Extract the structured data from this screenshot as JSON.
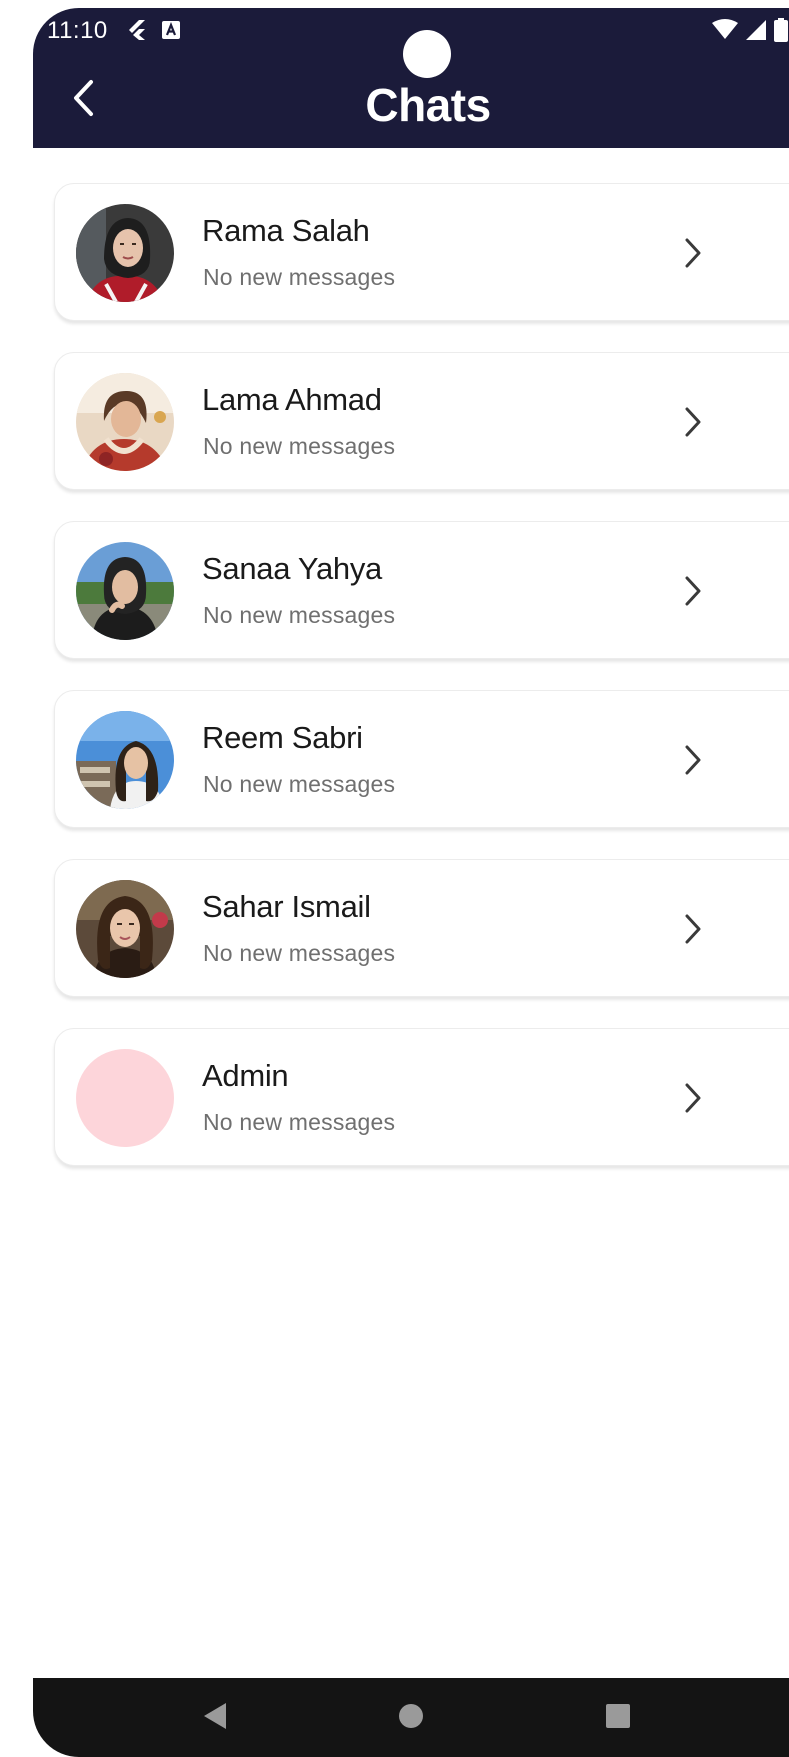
{
  "status_bar": {
    "time": "11:10",
    "left_icons": [
      "flutter-icon",
      "a-icon"
    ],
    "right_icons": [
      "wifi-icon",
      "signal-icon",
      "battery-icon"
    ]
  },
  "header": {
    "title": "Chats",
    "back_icon": "chevron-left-icon",
    "background_color": "#1b1b3a"
  },
  "chats": [
    {
      "name": "Rama Salah",
      "status": "No new messages",
      "avatar": "photo"
    },
    {
      "name": "Lama Ahmad",
      "status": "No new messages",
      "avatar": "photo"
    },
    {
      "name": "Sanaa Yahya",
      "status": "No new messages",
      "avatar": "photo"
    },
    {
      "name": "Reem Sabri",
      "status": "No new messages",
      "avatar": "photo"
    },
    {
      "name": "Sahar Ismail",
      "status": "No new messages",
      "avatar": "photo"
    },
    {
      "name": "Admin",
      "status": "No new messages",
      "avatar": "placeholder",
      "avatar_color": "#fdd5da"
    }
  ],
  "navbar": {
    "icons": [
      "nav-back-icon",
      "nav-home-icon",
      "nav-recents-icon"
    ]
  }
}
